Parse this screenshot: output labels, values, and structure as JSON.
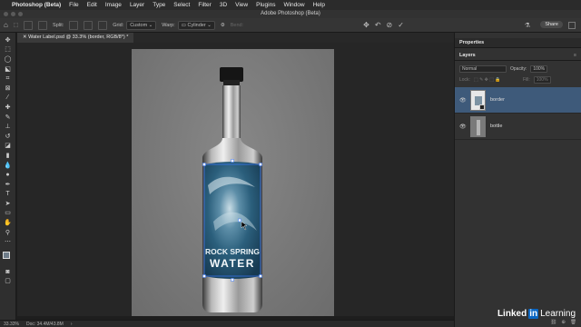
{
  "menubar": {
    "apple": "",
    "app_name": "Photoshop (Beta)",
    "items": [
      "File",
      "Edit",
      "Image",
      "Layer",
      "Type",
      "Select",
      "Filter",
      "3D",
      "View",
      "Plugins",
      "Window",
      "Help"
    ]
  },
  "window": {
    "title": "Adobe Photoshop (Beta)"
  },
  "options": {
    "split_label": "Split:",
    "grid_label": "Grid:",
    "grid_value": "Custom",
    "warp_label": "Warp:",
    "warp_value": "Cylinder",
    "bend_label": "Bend:",
    "share_label": "Share"
  },
  "document": {
    "tab_label": "Water Label.psd @ 33.3% (border, RGB/8*) *"
  },
  "label_art": {
    "line1": "ROCK SPRING",
    "line2": "WATER"
  },
  "status": {
    "zoom": "33.33%",
    "doc_size": "Doc: 34.4M/43.8M"
  },
  "panels": {
    "properties_title": "Properties",
    "layers_title": "Layers",
    "blend_mode": "Normal",
    "opacity_label": "Opacity:",
    "opacity_value": "100%",
    "lock_label": "Lock:",
    "fill_label": "Fill:",
    "fill_value": "100%",
    "layers": [
      {
        "name": "border",
        "selected": true
      },
      {
        "name": "bottle",
        "selected": false
      }
    ]
  },
  "watermark": {
    "brand": "Linked",
    "in": "in",
    "suffix": "Learning"
  },
  "colors": {
    "selection": "#3e5a7a",
    "accent": "#0a66c2"
  }
}
